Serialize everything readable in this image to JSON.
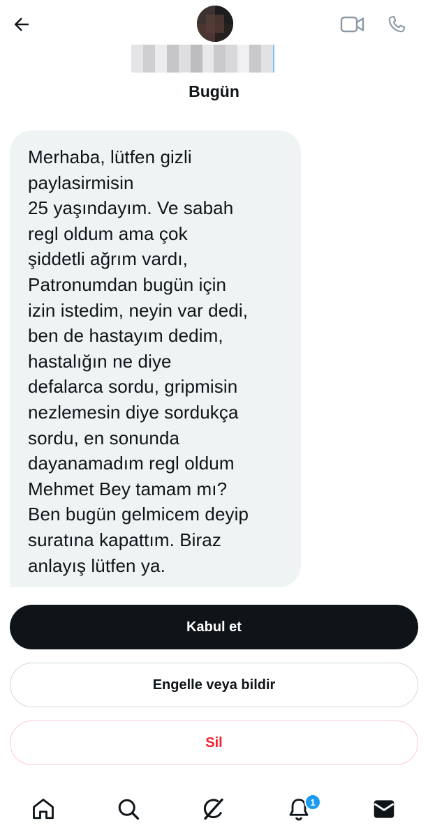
{
  "header": {
    "back_icon": "arrow-left-icon",
    "avatar": "blurred-avatar",
    "video_icon": "video-camera-icon",
    "call_icon": "phone-icon"
  },
  "conversation": {
    "day_label": "Bugün",
    "message": {
      "text": "Merhaba, lütfen gizli\npaylasirmisin\n25 yaşındayım. Ve sabah\nregl oldum ama çok\nşiddetli ağrım vardı,\nPatronumdan bugün için\nizin istedim, neyin var dedi,\nben de hastayım dedim,\nhastalığın ne diye\ndefalarca sordu, gripmisin\nnezlemesin  diye sordukça\nsordu, en sonunda\ndayanamadım regl oldum\nMehmet Bey tamam mı?\nBen bugün gelmicem deyip\nsuratına kapattım. Biraz\nanlayış lütfen ya."
    }
  },
  "actions": {
    "accept_label": "Kabul et",
    "block_label": "Engelle veya bildir",
    "delete_label": "Sil"
  },
  "tabbar": {
    "items": [
      {
        "icon": "home-icon"
      },
      {
        "icon": "search-icon"
      },
      {
        "icon": "grok-icon"
      },
      {
        "icon": "bell-icon"
      },
      {
        "icon": "mail-icon"
      }
    ],
    "notifications_badge": "1"
  },
  "colors": {
    "accept_bg": "#0f1419",
    "bubble_bg": "#eff3f4",
    "delete_text": "#f4212e",
    "badge": "#1d9bf0"
  }
}
